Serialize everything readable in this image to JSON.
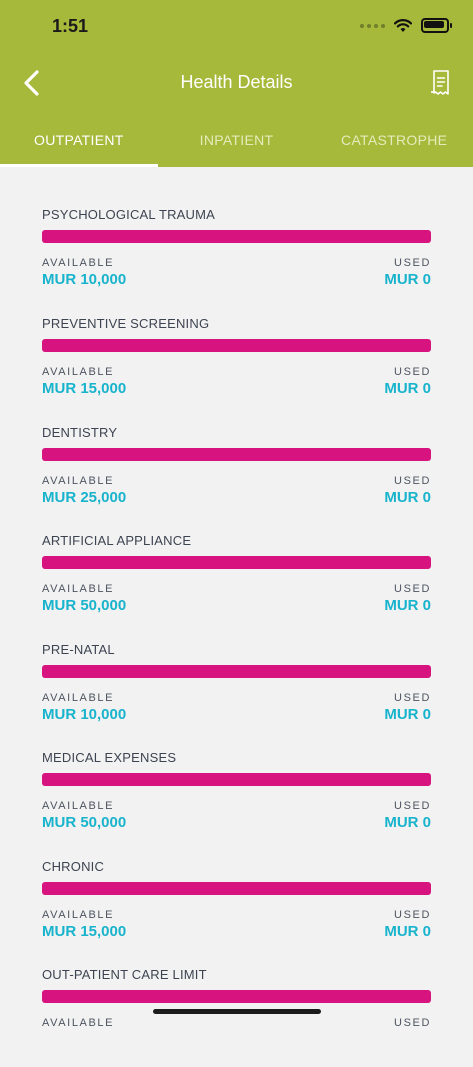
{
  "status_bar": {
    "time": "1:51",
    "icons": [
      "signal-icon",
      "wifi-icon",
      "battery-icon"
    ]
  },
  "header": {
    "title": "Health Details",
    "back_icon": "chevron-left-icon",
    "action_icon": "receipt-icon"
  },
  "tabs": [
    {
      "label": "OUTPATIENT",
      "active": true
    },
    {
      "label": "INPATIENT",
      "active": false
    },
    {
      "label": "CATASTROPHE",
      "active": false
    }
  ],
  "labels": {
    "available": "AVAILABLE",
    "used": "USED"
  },
  "benefits": [
    {
      "name": "PSYCHOLOGICAL TRAUMA",
      "available": "MUR 10,000",
      "used": "MUR 0"
    },
    {
      "name": "PREVENTIVE SCREENING",
      "available": "MUR 15,000",
      "used": "MUR 0"
    },
    {
      "name": "DENTISTRY",
      "available": "MUR 25,000",
      "used": "MUR 0"
    },
    {
      "name": "ARTIFICIAL APPLIANCE",
      "available": "MUR 50,000",
      "used": "MUR 0"
    },
    {
      "name": "PRE-NATAL",
      "available": "MUR 10,000",
      "used": "MUR 0"
    },
    {
      "name": "MEDICAL EXPENSES",
      "available": "MUR 50,000",
      "used": "MUR 0"
    },
    {
      "name": "CHRONIC",
      "available": "MUR 15,000",
      "used": "MUR 0"
    },
    {
      "name": "OUT-PATIENT CARE LIMIT",
      "available": "",
      "used": ""
    }
  ],
  "colors": {
    "header": "#a6b93a",
    "bar": "#d6137f",
    "amount": "#18b3cc",
    "background": "#f2f2f2"
  }
}
